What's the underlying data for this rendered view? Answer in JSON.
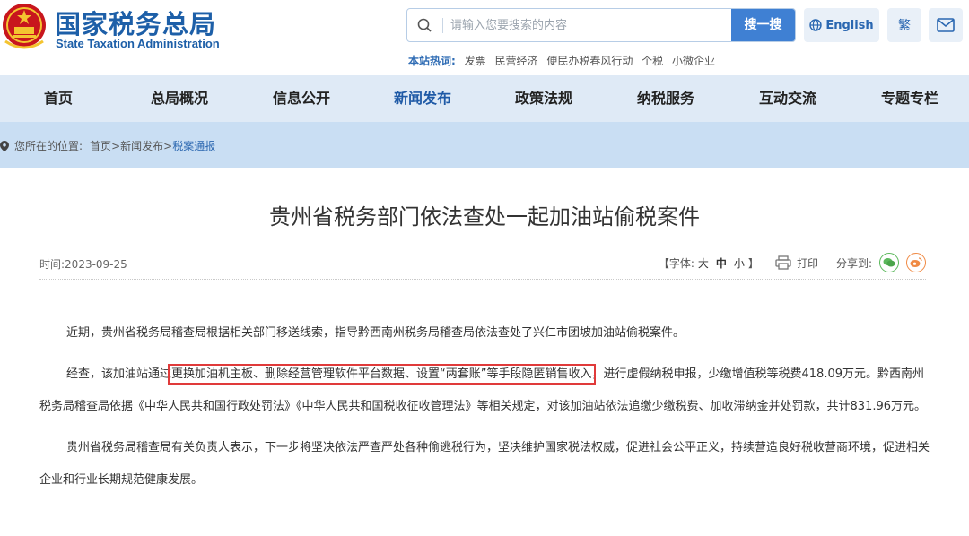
{
  "header": {
    "logo_cn": "国家税务总局",
    "logo_en": "State Taxation Administration",
    "search_placeholder": "请输入您要搜索的内容",
    "search_button": "搜一搜",
    "english_label": "English",
    "traditional_label": "繁",
    "hotwords_label": "本站热词:",
    "hotwords": [
      "发票",
      "民营经济",
      "便民办税春风行动",
      "个税",
      "小微企业"
    ]
  },
  "nav": {
    "items": [
      "首页",
      "总局概况",
      "信息公开",
      "新闻发布",
      "政策法规",
      "纳税服务",
      "互动交流",
      "专题专栏"
    ],
    "active": "新闻发布"
  },
  "breadcrumb": {
    "prefix": "您所在的位置:",
    "home": "首页",
    "sep1": ">",
    "section": "新闻发布",
    "sep2": ">",
    "current": "税案通报"
  },
  "article": {
    "title": "贵州省税务部门依法查处一起加油站偷税案件",
    "time": "时间:2023-09-25",
    "font_label_open": "【字体:",
    "font_large": "大",
    "font_medium": "中",
    "font_small": "小",
    "font_label_close": "】",
    "print_label": "打印",
    "share_label": "分享到:",
    "p1": "近期，贵州省税务局稽查局根据相关部门移送线索，指导黔西南州税务局稽查局依法查处了兴仁市团坡加油站偷税案件。",
    "p2_before": "经查，该加油站通过",
    "p2_highlight": "更换加油机主板、删除经营管理软件平台数据、设置“两套账”等手段隐匿销售收入",
    "p2_after": "，进行虚假纳税申报，少缴增值税等税费418.09万元。黔西南州税务局稽查局依据《中华人民共和国行政处罚法》《中华人民共和国税收征收管理法》等相关规定，对该加油站依法追缴少缴税费、加收滞纳金并处罚款，共计831.96万元。",
    "p3": "贵州省税务局稽查局有关负责人表示，下一步将坚决依法严查严处各种偷逃税行为，坚决维护国家税法权威，促进社会公平正义，持续营造良好税收营商环境，促进相关企业和行业长期规范健康发展。"
  },
  "colors": {
    "brand_blue": "#1d5fa8",
    "nav_bg": "#dfeaf6",
    "crumb_bg": "#c9def3",
    "highlight_border": "#e03a3a"
  }
}
